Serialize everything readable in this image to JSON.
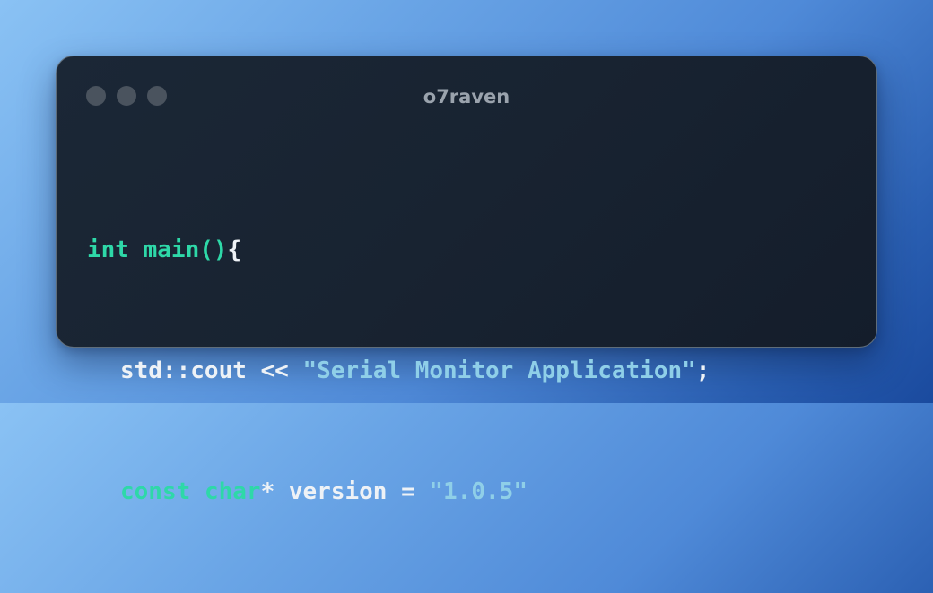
{
  "window": {
    "title": "o7raven"
  },
  "code": {
    "line1": {
      "keyword": "int",
      "function": "main()",
      "brace": "{"
    },
    "line2": {
      "stream": "std::cout <<",
      "string": "\"Serial Monitor Application\"",
      "end": ";"
    },
    "line3": {
      "keyword1": "const",
      "keyword2": "char",
      "rest": "* version =",
      "string": "\"1.0.5\""
    }
  },
  "colors": {
    "keyword": "#2ed8a8",
    "string": "#8fcfe8",
    "text": "#eef2f6",
    "title": "#9aa3ad",
    "window_bg": "#182331",
    "dot": "#4a535e"
  },
  "icons": [
    "window-dot-icon",
    "window-dot-icon",
    "window-dot-icon"
  ]
}
